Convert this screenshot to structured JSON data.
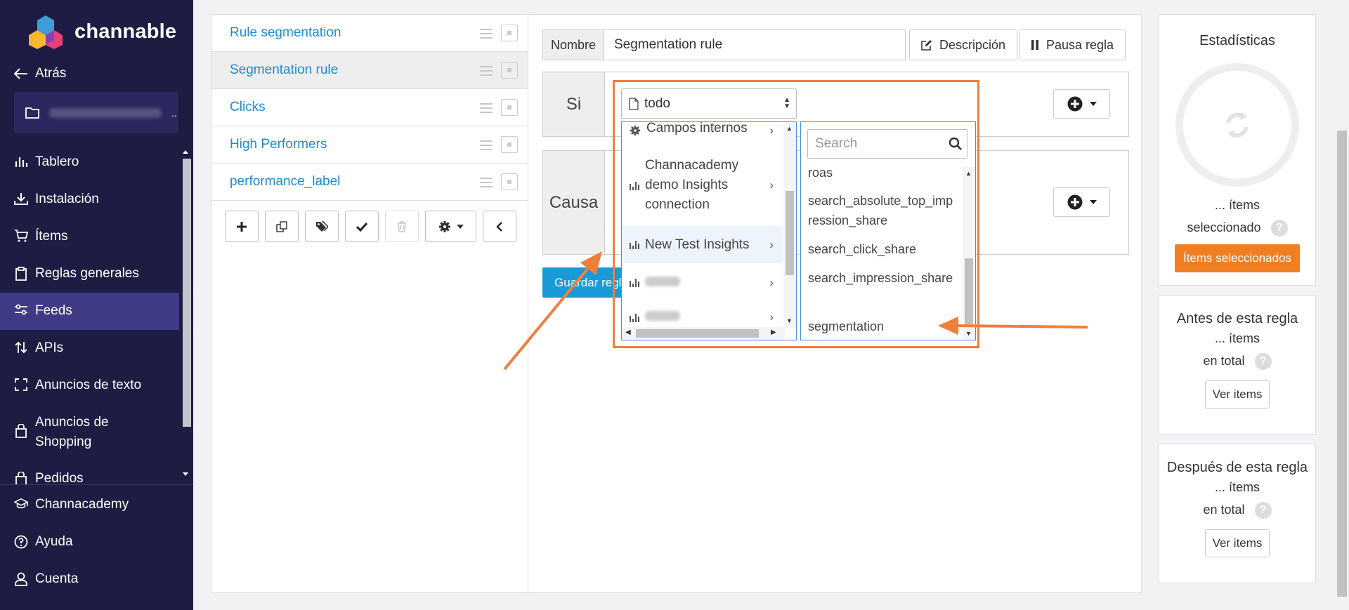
{
  "app": {
    "name": "channable"
  },
  "sidebar": {
    "back": "Atrás",
    "items": [
      {
        "label": "Tablero"
      },
      {
        "label": "Instalación"
      },
      {
        "label": "Ítems"
      },
      {
        "label": "Reglas generales"
      },
      {
        "label": "Feeds"
      },
      {
        "label": "APIs"
      },
      {
        "label": "Anuncios de texto"
      },
      {
        "label": "Anuncios de Shopping"
      },
      {
        "label": "Pedidos"
      }
    ],
    "bottom": [
      {
        "label": "Channacademy"
      },
      {
        "label": "Ayuda"
      },
      {
        "label": "Cuenta"
      }
    ]
  },
  "rules": [
    {
      "label": "Rule segmentation"
    },
    {
      "label": "Segmentation rule"
    },
    {
      "label": "Clicks"
    },
    {
      "label": "High Performers"
    },
    {
      "label": "performance_label"
    }
  ],
  "editor": {
    "name_label": "Nombre",
    "name_value": "Segmentation rule",
    "description_btn": "Descripción",
    "pause_btn": "Pausa regla",
    "if_label": "Si",
    "cause_label": "Causa",
    "save_btn": "Guardar regla",
    "select_value": "todo"
  },
  "dropdown": {
    "left_items": [
      {
        "label": "Campos internos"
      },
      {
        "label": "Channacademy demo Insights connection"
      },
      {
        "label": "New Test Insights"
      }
    ],
    "search_placeholder": "Search",
    "right_items": [
      {
        "label": "roas"
      },
      {
        "label": "search_absolute_top_impression_share"
      },
      {
        "label": "search_click_share"
      },
      {
        "label": "search_impression_share"
      },
      {
        "label": "segmentation"
      }
    ]
  },
  "stats": {
    "title": "Estadísticas",
    "items_dots": "... ítems",
    "selected_label": "seleccionado",
    "selected_btn": "Ítems seleccionados",
    "before_title": "Antes de esta regla",
    "after_title": "Después de esta regla",
    "in_total": "en total",
    "view_items": "Ver items",
    "qmark": "?"
  },
  "colors": {
    "sidebar": "#1f1c44",
    "active": "#3e3a85",
    "accent": "#f07f24",
    "link": "#1e8bd6",
    "primary": "#1a9ad6"
  }
}
